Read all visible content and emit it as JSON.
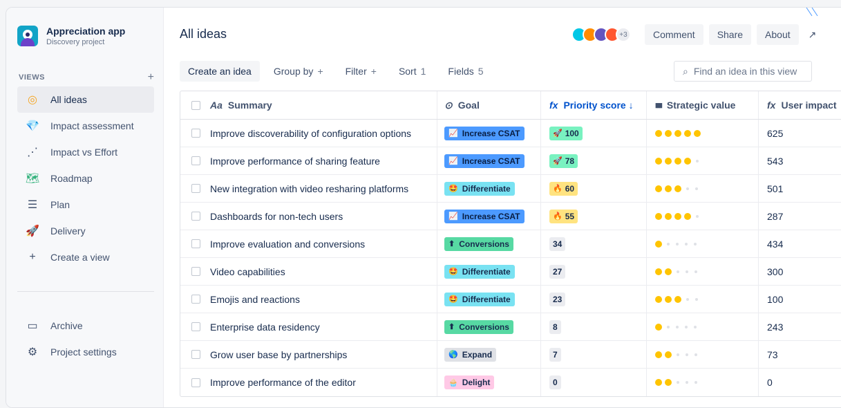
{
  "sidebar": {
    "app_name": "Appreciation app",
    "app_sub": "Discovery project",
    "views_label": "VIEWS",
    "add_icon": "+",
    "items": [
      {
        "label": "All ideas",
        "icon": "compass-icon",
        "glyph": "◎",
        "color": "#f5a623"
      },
      {
        "label": "Impact assessment",
        "icon": "diamond-icon",
        "glyph": "💎",
        "color": "#00b8d9"
      },
      {
        "label": "Impact vs Effort",
        "icon": "scatter-icon",
        "glyph": "⋰",
        "color": "#42526e"
      },
      {
        "label": "Roadmap",
        "icon": "map-icon",
        "glyph": "🗺",
        "color": "#36b37e"
      },
      {
        "label": "Plan",
        "icon": "list-icon",
        "glyph": "☰",
        "color": "#42526e"
      },
      {
        "label": "Delivery",
        "icon": "rocket-icon",
        "glyph": "🚀",
        "color": "#ff5630"
      },
      {
        "label": "Create a view",
        "icon": "plus-icon",
        "glyph": "+",
        "color": "#42526e"
      }
    ],
    "bottom": [
      {
        "label": "Archive",
        "icon": "archive-icon",
        "glyph": "▭"
      },
      {
        "label": "Project settings",
        "icon": "gear-icon",
        "glyph": "⚙"
      }
    ]
  },
  "header": {
    "title": "All ideas",
    "more_users": "+3",
    "comment": "Comment",
    "share": "Share",
    "about": "About",
    "expand_icon": "↗"
  },
  "toolbar": {
    "create": "Create an idea",
    "group_by": "Group by",
    "group_extra": "+",
    "filter": "Filter",
    "filter_extra": "+",
    "sort": "Sort",
    "sort_count": "1",
    "fields": "Fields",
    "fields_count": "5",
    "search_placeholder": "Find an idea in this view",
    "search_icon": "⌕"
  },
  "table": {
    "headers": {
      "summary_icon": "Aa",
      "summary": "Summary",
      "goal_icon": "⊙",
      "goal": "Goal",
      "priority_icon": "fx",
      "priority": "Priority score ↓",
      "strategic_icon": "▮▮▮",
      "strategic": "Strategic value",
      "impact_icon": "fx",
      "impact": "User impact"
    },
    "rows": [
      {
        "summary": "Improve discoverability of configuration options",
        "goal": "Increase CSAT",
        "goal_icon": "📈",
        "score": "100",
        "score_icon": "🚀",
        "strategic": 5,
        "impact": "625"
      },
      {
        "summary": "Improve performance of sharing feature",
        "goal": "Increase CSAT",
        "goal_icon": "📈",
        "score": "78",
        "score_icon": "🚀",
        "strategic": 4,
        "impact": "543"
      },
      {
        "summary": "New integration with video resharing platforms",
        "goal": "Differentiate",
        "goal_icon": "🤩",
        "score": "60",
        "score_icon": "🔥",
        "strategic": 3,
        "impact": "501"
      },
      {
        "summary": "Dashboards for non-tech users",
        "goal": "Increase CSAT",
        "goal_icon": "📈",
        "score": "55",
        "score_icon": "🔥",
        "strategic": 4,
        "impact": "287"
      },
      {
        "summary": "Improve evaluation and conversions",
        "goal": "Conversions",
        "goal_icon": "⬆",
        "score": "34",
        "score_icon": "",
        "strategic": 1,
        "impact": "434"
      },
      {
        "summary": "Video capabilities",
        "goal": "Differentiate",
        "goal_icon": "🤩",
        "score": "27",
        "score_icon": "",
        "strategic": 2,
        "impact": "300"
      },
      {
        "summary": "Emojis and reactions",
        "goal": "Differentiate",
        "goal_icon": "🤩",
        "score": "23",
        "score_icon": "",
        "strategic": 3,
        "impact": "100"
      },
      {
        "summary": "Enterprise data residency",
        "goal": "Conversions",
        "goal_icon": "⬆",
        "score": "8",
        "score_icon": "",
        "strategic": 1,
        "impact": "243"
      },
      {
        "summary": "Grow user base by partnerships",
        "goal": "Expand",
        "goal_icon": "🌎",
        "score": "7",
        "score_icon": "",
        "strategic": 2,
        "impact": "73"
      },
      {
        "summary": "Improve performance of the editor",
        "goal": "Delight",
        "goal_icon": "🧁",
        "score": "0",
        "score_icon": "",
        "strategic": 2,
        "impact": "0"
      }
    ]
  },
  "colors": {
    "goal_bg": {
      "Increase CSAT": "#4c9aff",
      "Differentiate": "#79e2f2",
      "Conversions": "#57d9a3",
      "Expand": "#dfe1e6",
      "Delight": "#ffc9e6"
    },
    "score_bg": {
      "100": "#79f2c0",
      "78": "#79f2c0",
      "60": "#ffe380",
      "55": "#ffe380"
    },
    "accent": "#0052cc",
    "star": "#ffc400"
  }
}
